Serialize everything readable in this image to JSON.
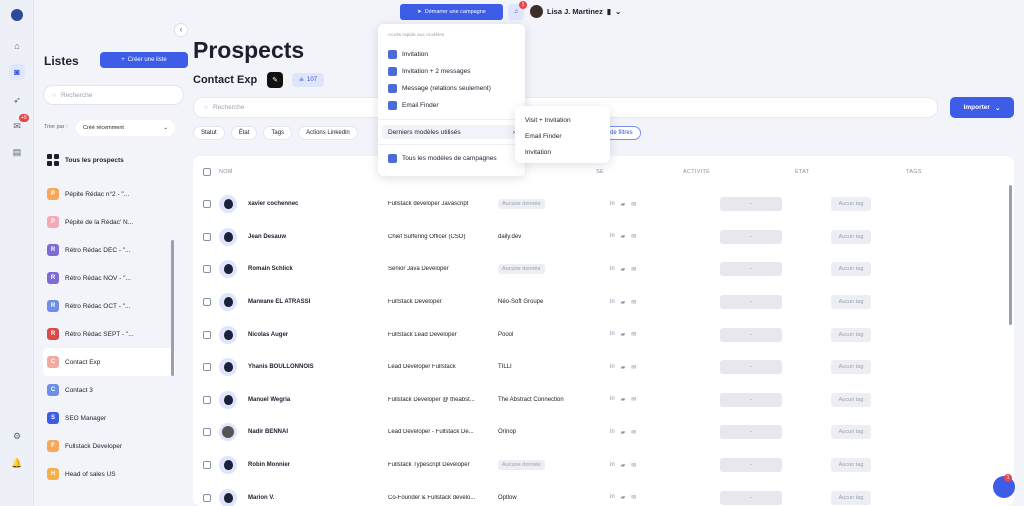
{
  "rail": {
    "badge": "+9"
  },
  "lists": {
    "title": "Listes",
    "create_label": "Créer une liste",
    "search_placeholder": "Recherche",
    "sort_label": "Trier par :",
    "sort_value": "Créé récemment",
    "items": [
      {
        "label": "Tous les prospects",
        "letter": "",
        "color": ""
      },
      {
        "label": "Pépite Rédac n°2 - \"...",
        "letter": "P",
        "color": "#f5a85a"
      },
      {
        "label": "Pépite de la Rédac' N...",
        "letter": "P",
        "color": "#f2a9b8"
      },
      {
        "label": "Rétro Rédac DEC - \"...",
        "letter": "R",
        "color": "#7d6bd6"
      },
      {
        "label": "Rétro Rédac NOV - \"...",
        "letter": "R",
        "color": "#7d6bd6"
      },
      {
        "label": "Rétro Rédac OCT - \"...",
        "letter": "R",
        "color": "#6e8fe8"
      },
      {
        "label": "Rétro Rédac SEPT - \"...",
        "letter": "R",
        "color": "#d94b4b"
      },
      {
        "label": "Contact Exp",
        "letter": "C",
        "color": "#f2a9a0"
      },
      {
        "label": "Contact 3",
        "letter": "C",
        "color": "#6e8fe8"
      },
      {
        "label": "SEO Manager",
        "letter": "S",
        "color": "#3d5ce8"
      },
      {
        "label": "Fullstack Developer",
        "letter": "F",
        "color": "#f5a85a"
      },
      {
        "label": "Head of sales US",
        "letter": "H",
        "color": "#f5b04a"
      }
    ]
  },
  "main": {
    "title": "Prospects",
    "subtitle": "Contact Exp",
    "count": "107",
    "search_placeholder": "Recherche",
    "import_label": "Importer",
    "filters": [
      "Statut",
      "État",
      "Tags",
      "Actions Linkedin"
    ],
    "filter_link": "de filtres",
    "columns": {
      "name": "NOM",
      "company": "SE",
      "activity": "ACTIVITÉ",
      "etat": "ÉTAT",
      "tags": "TAGS"
    },
    "rows": [
      {
        "name": "xavier cochennec",
        "job": "Fullstack developer Javascript",
        "company": "",
        "company_placeholder": "Aucune donnée",
        "etat": "-",
        "tags": "Aucun tag",
        "photo": false
      },
      {
        "name": "Jean Desauw",
        "job": "Chief Suffering Officer (CSO)",
        "company": "daily.dev",
        "company_placeholder": "",
        "etat": "-",
        "tags": "Aucun tag",
        "photo": false
      },
      {
        "name": "Romain Schlick",
        "job": "Senior Java Developer",
        "company": "",
        "company_placeholder": "Aucune donnée",
        "etat": "-",
        "tags": "Aucun tag",
        "photo": false
      },
      {
        "name": "Marwane EL ATRASSI",
        "job": "FullStack Developer",
        "company": "Néo-Soft Groupe",
        "company_placeholder": "",
        "etat": "-",
        "tags": "Aucun tag",
        "photo": false
      },
      {
        "name": "Nicolas Auger",
        "job": "FullStack Lead Developer",
        "company": "Poool",
        "company_placeholder": "",
        "etat": "-",
        "tags": "Aucun tag",
        "photo": false
      },
      {
        "name": "Yhanis BOULLONNOIS",
        "job": "Lead Developer Fullstack",
        "company": "TILLI",
        "company_placeholder": "",
        "etat": "-",
        "tags": "Aucun tag",
        "photo": false
      },
      {
        "name": "Manuel Wegria",
        "job": "Fullstack Developer @ theabst...",
        "company": "The Abstract Connection",
        "company_placeholder": "",
        "etat": "-",
        "tags": "Aucun tag",
        "photo": false
      },
      {
        "name": "Nadir BENNAI",
        "job": "Lead Developer - Fullstack De...",
        "company": "Orinop",
        "company_placeholder": "",
        "etat": "-",
        "tags": "Aucun tag",
        "photo": true
      },
      {
        "name": "Robin Monnier",
        "job": "Fullstack Typescript Developer",
        "company": "",
        "company_placeholder": "Aucune donnée",
        "etat": "-",
        "tags": "Aucun tag",
        "photo": false
      },
      {
        "name": "Marion V.",
        "job": "Co-Founder & Fullstack develo...",
        "company": "Optlow",
        "company_placeholder": "",
        "etat": "-",
        "tags": "Aucun tag",
        "photo": false
      }
    ]
  },
  "top": {
    "campaign_label": "Démarrer une campagne",
    "bell_badge": "1",
    "user_name": "Lisa J. Martinez"
  },
  "dropdown": {
    "header": "Accès rapide aux modèles",
    "options": [
      "Invitation",
      "Invitation + 2 messages",
      "Message (relations seulement)",
      "Email Finder"
    ],
    "recent_label": "Derniers modèles utilisés",
    "all_label": "Tous les modèles de campagnes",
    "submenu": [
      "Visit + Invitation",
      "Email Finder",
      "Invitation"
    ]
  },
  "chat_badge": "1"
}
